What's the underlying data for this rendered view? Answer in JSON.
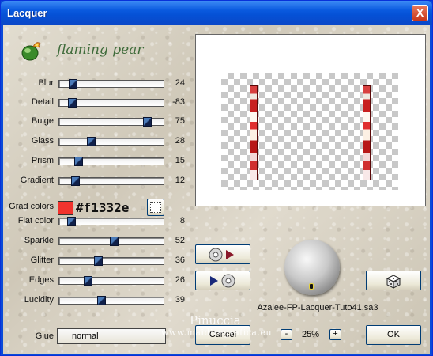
{
  "window": {
    "title": "Lacquer",
    "close_label": "X"
  },
  "brand": {
    "name": "flaming pear",
    "logo_icon": "flaming-pear-logo-icon"
  },
  "sliders": [
    {
      "label": "Blur",
      "value": "24",
      "level": 0.13
    },
    {
      "label": "Detail",
      "value": "-83",
      "level": 0.12
    },
    {
      "label": "Bulge",
      "value": "75",
      "level": 0.84
    },
    {
      "label": "Glass",
      "value": "28",
      "level": 0.3
    },
    {
      "label": "Prism",
      "value": "15",
      "level": 0.18
    },
    {
      "label": "Gradient",
      "value": "12",
      "level": 0.15
    },
    {
      "label": "Flat color",
      "value": "8",
      "level": 0.11
    },
    {
      "label": "Sparkle",
      "value": "52",
      "level": 0.52
    },
    {
      "label": "Glitter",
      "value": "36",
      "level": 0.37
    },
    {
      "label": "Edges",
      "value": "26",
      "level": 0.27
    },
    {
      "label": "Lucidity",
      "value": "39",
      "level": 0.4
    }
  ],
  "grad_colors": {
    "label": "Grad colors",
    "hex_text": "#f1332e",
    "swatch_color": "#f1332e",
    "second_swatch_color": "#ffffff"
  },
  "glue": {
    "label": "Glue",
    "value": "normal"
  },
  "buttons": {
    "load_preset_icon": "cd-play-icon",
    "save_preset_icon": "play-cd-icon",
    "random_icon": "dice-icon",
    "cancel_label": "Cancel",
    "ok_label": "OK"
  },
  "preview": {
    "filename": "Azalee-FP-Lacquer-Tuto41.sa3"
  },
  "zoom": {
    "minus_label": "-",
    "value": "25%",
    "plus_label": "+"
  },
  "watermark": {
    "line1": "Pinuccia",
    "line2": "www.maidiregrafica.eu"
  },
  "colors": {
    "title_bar": "#0a5adf",
    "thumb": "#1a3a7a",
    "brand_text": "#3e6b3a"
  }
}
